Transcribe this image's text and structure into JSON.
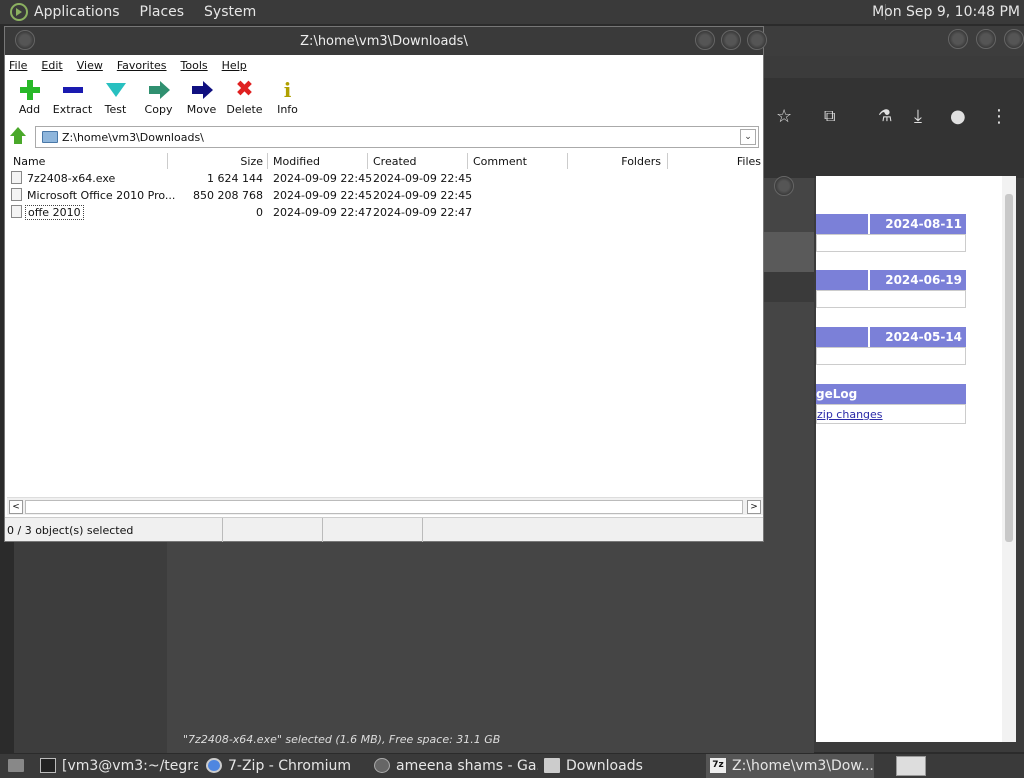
{
  "top_panel": {
    "menus": [
      "Applications",
      "Places",
      "System"
    ],
    "clock": "Mon Sep  9, 10:48 PM"
  },
  "background_files": {
    "status": "\"7z2408-x64.exe\" selected (1.6 MB), Free space: 31.1 GB"
  },
  "browser_page": {
    "news": [
      {
        "date": "2024-08-11"
      },
      {
        "date": "2024-06-19"
      },
      {
        "date": "2024-05-14"
      }
    ],
    "changelog_title": "geLog",
    "changelog_link": "zip changes"
  },
  "zip_window": {
    "title": "Z:\\home\\vm3\\Downloads\\",
    "menu": [
      "File",
      "Edit",
      "View",
      "Favorites",
      "Tools",
      "Help"
    ],
    "toolbar": [
      {
        "label": "Add",
        "icon": "add-icon"
      },
      {
        "label": "Extract",
        "icon": "extract-icon"
      },
      {
        "label": "Test",
        "icon": "test-icon"
      },
      {
        "label": "Copy",
        "icon": "copy-icon"
      },
      {
        "label": "Move",
        "icon": "move-icon"
      },
      {
        "label": "Delete",
        "icon": "delete-icon"
      },
      {
        "label": "Info",
        "icon": "info-icon"
      }
    ],
    "delete_glyph": "✖",
    "info_glyph": "i",
    "address": "Z:\\home\\vm3\\Downloads\\",
    "columns": [
      "Name",
      "Size",
      "Modified",
      "Created",
      "Comment",
      "Folders",
      "Files"
    ],
    "files": [
      {
        "name": "7z2408-x64.exe",
        "size": "1 624 144",
        "modified": "2024-09-09 22:45",
        "created": "2024-09-09 22:45"
      },
      {
        "name": "Microsoft Office 2010 Pro...",
        "size": "850 208 768",
        "modified": "2024-09-09 22:45",
        "created": "2024-09-09 22:45"
      },
      {
        "name": "offe 2010",
        "size": "0",
        "modified": "2024-09-09 22:47",
        "created": "2024-09-09 22:47"
      }
    ],
    "status": "0 / 3 object(s) selected"
  },
  "taskbar": {
    "tasks": [
      {
        "label": "[vm3@vm3:~/tegra...",
        "icon": "terminal-icon"
      },
      {
        "label": "7-Zip - Chromium",
        "icon": "chromium-icon"
      },
      {
        "label": "ameena shams - Ga...",
        "icon": "browser-icon"
      },
      {
        "label": "Downloads",
        "icon": "folder-icon"
      },
      {
        "label": "Z:\\home\\vm3\\Dow...",
        "icon": "7zip-icon"
      }
    ],
    "sevenzip_glyph": "7z"
  },
  "colors": {
    "news_header": "#7b80d8",
    "panel": "#3a3a3a",
    "add_green": "#28b828",
    "delete_red": "#e02020"
  }
}
